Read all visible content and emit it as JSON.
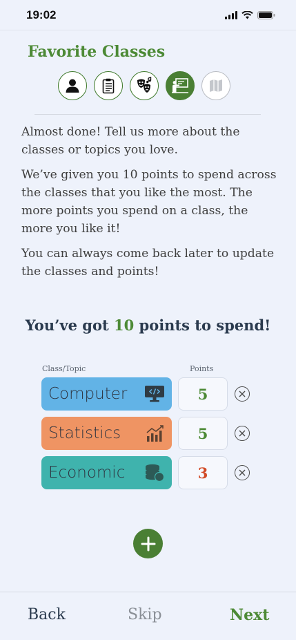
{
  "status_bar": {
    "time": "19:02"
  },
  "title": "Favorite Classes",
  "steps": [
    {
      "icon": "person-icon",
      "state": "done"
    },
    {
      "icon": "clipboard-icon",
      "state": "done"
    },
    {
      "icon": "theater-masks-icon",
      "state": "done"
    },
    {
      "icon": "teacher-board-icon",
      "state": "active"
    },
    {
      "icon": "map-icon",
      "state": "disabled"
    }
  ],
  "intro": {
    "p1": "Almost done! Tell us more about the classes or topics you love.",
    "p2": "We’ve given you 10 points to spend across the classes that you like the most. The more points you spend on a class, the more you like it!",
    "p3": "You can always come back later to update the classes and points!"
  },
  "spend": {
    "prefix": "You’ve got ",
    "points": "10",
    "suffix": " points to spend!"
  },
  "columns": {
    "class": "Class/Topic",
    "points": "Points"
  },
  "rows": [
    {
      "label": "Computer",
      "points": "5",
      "color": "#62b3e6",
      "icon": "computer-icon",
      "points_color": "#4d8a36"
    },
    {
      "label": "Statistics",
      "points": "5",
      "color": "#ef9463",
      "icon": "chart-icon",
      "points_color": "#4d8a36"
    },
    {
      "label": "Economic",
      "points": "3",
      "color": "#3fb3ad",
      "icon": "coins-icon",
      "points_color": "#d24a26"
    }
  ],
  "footer": {
    "back": "Back",
    "skip": "Skip",
    "next": "Next"
  },
  "colors": {
    "accent": "#4d8a36",
    "background": "#eef2fb",
    "heading": "#2a3a4e"
  }
}
